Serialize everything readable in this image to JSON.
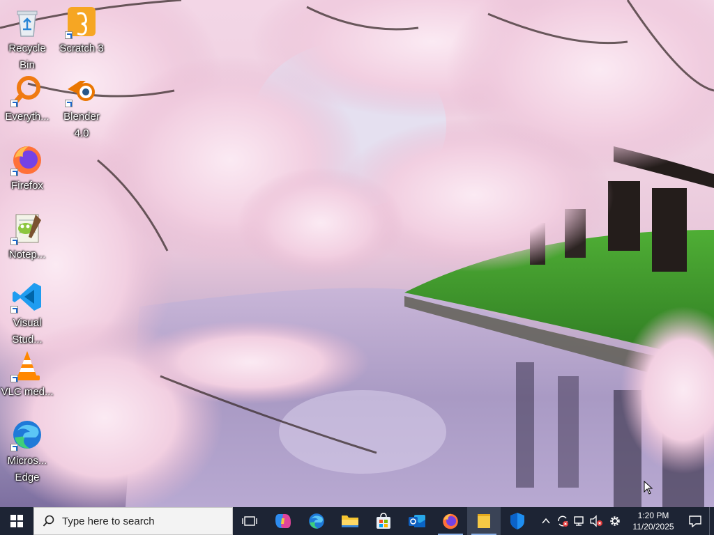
{
  "desktop": {
    "icons": [
      {
        "label": "Recycle Bin",
        "icon": "recycle-bin-icon"
      },
      {
        "label": "Scratch 3",
        "icon": "scratch-icon"
      },
      {
        "label": "Everyth...",
        "icon": "everything-search-icon"
      },
      {
        "label": "Blender 4.0",
        "icon": "blender-icon"
      },
      {
        "label": "Firefox",
        "icon": "firefox-icon"
      },
      {
        "label": "Notep...",
        "icon": "notepad-plus-plus-icon"
      },
      {
        "label": "Visual Stud...",
        "icon": "vscode-icon"
      },
      {
        "label": "VLC med...",
        "icon": "vlc-icon"
      },
      {
        "label": "Micros... Edge",
        "icon": "edge-icon"
      }
    ]
  },
  "taskbar": {
    "search": {
      "placeholder": "Type here to search"
    },
    "apps": [
      {
        "name": "Task View",
        "icon": "task-view-icon"
      },
      {
        "name": "Copilot",
        "icon": "copilot-icon"
      },
      {
        "name": "Microsoft Edge",
        "icon": "edge-icon"
      },
      {
        "name": "File Explorer",
        "icon": "folder-icon"
      },
      {
        "name": "Microsoft Store",
        "icon": "store-icon"
      },
      {
        "name": "Outlook",
        "icon": "outlook-icon"
      },
      {
        "name": "Firefox",
        "icon": "firefox-icon"
      },
      {
        "name": "Sticky Notes",
        "icon": "sticky-notes-icon"
      },
      {
        "name": "Windows Security",
        "icon": "shield-icon"
      }
    ],
    "tray": {
      "time": "1:20 PM",
      "date": "11/20/2025"
    }
  },
  "colors": {
    "taskbar_bg": "#1d2434",
    "search_bg": "#f3f3f3",
    "accent": "#2f6fd6"
  }
}
